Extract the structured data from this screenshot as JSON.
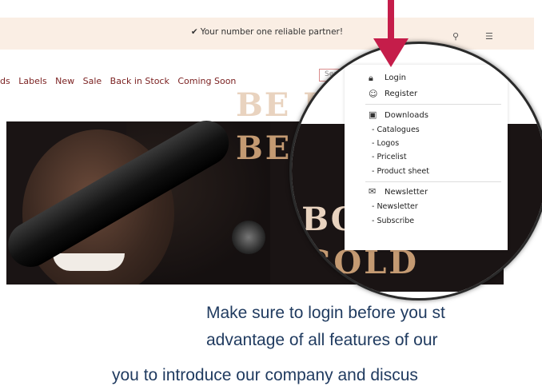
{
  "topbar": {
    "tagline": "Your number one reliable partner!",
    "check_icon": "check-icon",
    "user_icon": "user-icon",
    "filter_icon": "sliders-icon"
  },
  "nav": {
    "items": [
      "ds",
      "Labels",
      "New",
      "Sale",
      "Back in Stock",
      "Coming Soon"
    ]
  },
  "search": {
    "placeholder_fragment": "Sea"
  },
  "hero": {
    "line1": "BE BO",
    "line2": "BE GOLD"
  },
  "dropdown": {
    "login": "Login",
    "register": "Register",
    "downloads": "Downloads",
    "downloads_items": [
      "- Catalogues",
      "- Logos",
      "- Pricelist",
      "- Product sheet"
    ],
    "newsletter": "Newsletter",
    "newsletter_items": [
      "- Newsletter",
      "- Subscribe"
    ]
  },
  "caption": {
    "line1": "Make sure to login before you st",
    "line2": "advantage of all features of our",
    "line3": "you to introduce our company and discus"
  },
  "colors": {
    "topbar_bg": "#faeee4",
    "nav_text": "#7a1f1f",
    "arrow": "#c51d4a",
    "caption_text": "#1f3a5f"
  }
}
